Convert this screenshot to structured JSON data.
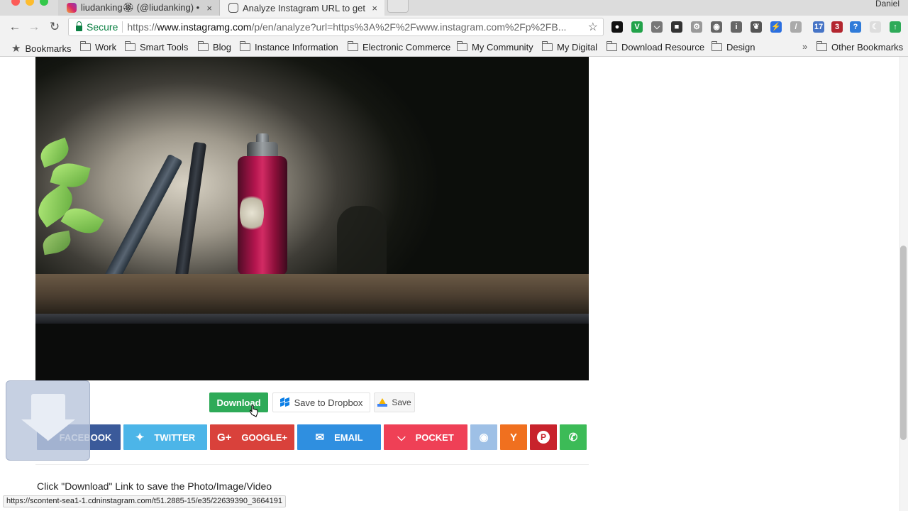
{
  "browser": {
    "user_name": "Daniel",
    "tabs": [
      {
        "title": "liudanking🏵 (@liudanking) • I",
        "close": "×"
      },
      {
        "title": "Analyze Instagram URL to get",
        "close": "×"
      }
    ],
    "nav": {
      "back": "←",
      "forward": "→",
      "reload": "↻"
    },
    "omnibox": {
      "secure_label": "Secure",
      "url_scheme": "https://",
      "url_host": "www.instagramg.com",
      "url_path": "/p/en/analyze?url=https%3A%2F%2Fwww.instagram.com%2Fp%2FB..."
    },
    "extensions": [
      {
        "name": "circle-extension-icon",
        "color": "#111111",
        "glyph": "●"
      },
      {
        "name": "v-extension-icon",
        "color": "#22a24a",
        "glyph": "V"
      },
      {
        "name": "pocket-extension-icon",
        "color": "#777777",
        "glyph": "⌵"
      },
      {
        "name": "grid-extension-icon",
        "color": "#333333",
        "glyph": "■"
      },
      {
        "name": "gear-extension-icon",
        "color": "#999999",
        "glyph": "⚙"
      },
      {
        "name": "camera-extension-icon",
        "color": "#666666",
        "glyph": "◉"
      },
      {
        "name": "info-extension-icon",
        "color": "#666666",
        "glyph": "i"
      },
      {
        "name": "evernote-extension-icon",
        "color": "#555555",
        "glyph": "❦"
      },
      {
        "name": "bolt-extension-icon",
        "color": "#2b6fe0",
        "glyph": "⚡"
      },
      {
        "name": "feather-extension-icon",
        "color": "#aaaaaa",
        "glyph": "/"
      },
      {
        "name": "calendar-extension-icon",
        "color": "#4674c6",
        "glyph": "17"
      },
      {
        "name": "shield-extension-icon",
        "color": "#b3262f",
        "glyph": "3"
      },
      {
        "name": "help-extension-icon",
        "color": "#2f7bd9",
        "glyph": "?"
      },
      {
        "name": "moon-extension-icon",
        "color": "#dddddd",
        "glyph": "☾"
      },
      {
        "name": "up-arrow-extension-icon",
        "color": "#2eaa58",
        "glyph": "↑"
      }
    ],
    "star": "☆"
  },
  "bookmarks": {
    "items": [
      "Bookmarks",
      "Work",
      "Smart Tools",
      "Blog",
      "Instance Information",
      "Electronic Commerce",
      "My Community",
      "My Digital",
      "Download Resource",
      "Design"
    ],
    "overflow": "»",
    "other": "Other Bookmarks"
  },
  "actions": {
    "download": "Download",
    "dropbox": "Save to Dropbox",
    "drive": "Save"
  },
  "share": [
    {
      "label": "FACEBOOK",
      "icon": "f",
      "color": "#3b5a9a"
    },
    {
      "label": "TWITTER",
      "icon": "✦",
      "color": "#4cb5e8"
    },
    {
      "label": "GOOGLE+",
      "icon": "G+",
      "color": "#d9413b"
    },
    {
      "label": "EMAIL",
      "icon": "✉",
      "color": "#2f8fe0"
    },
    {
      "label": "POCKET",
      "icon": "⌵",
      "color": "#ef4056"
    },
    {
      "label": "",
      "icon": "◉",
      "color": "#9ec0e6"
    },
    {
      "label": "",
      "icon": "Y",
      "color": "#f0701f"
    },
    {
      "label": "",
      "icon": "P",
      "color": "#c8232c"
    },
    {
      "label": "",
      "icon": "✆",
      "color": "#3cbb57"
    }
  ],
  "page": {
    "instruction": "Click \"Download\" Link to save the Photo/Image/Video"
  },
  "status": {
    "link_preview": "https://scontent-sea1-1.cdninstagram.com/t51.2885-15/e35/22639390_3664191"
  }
}
